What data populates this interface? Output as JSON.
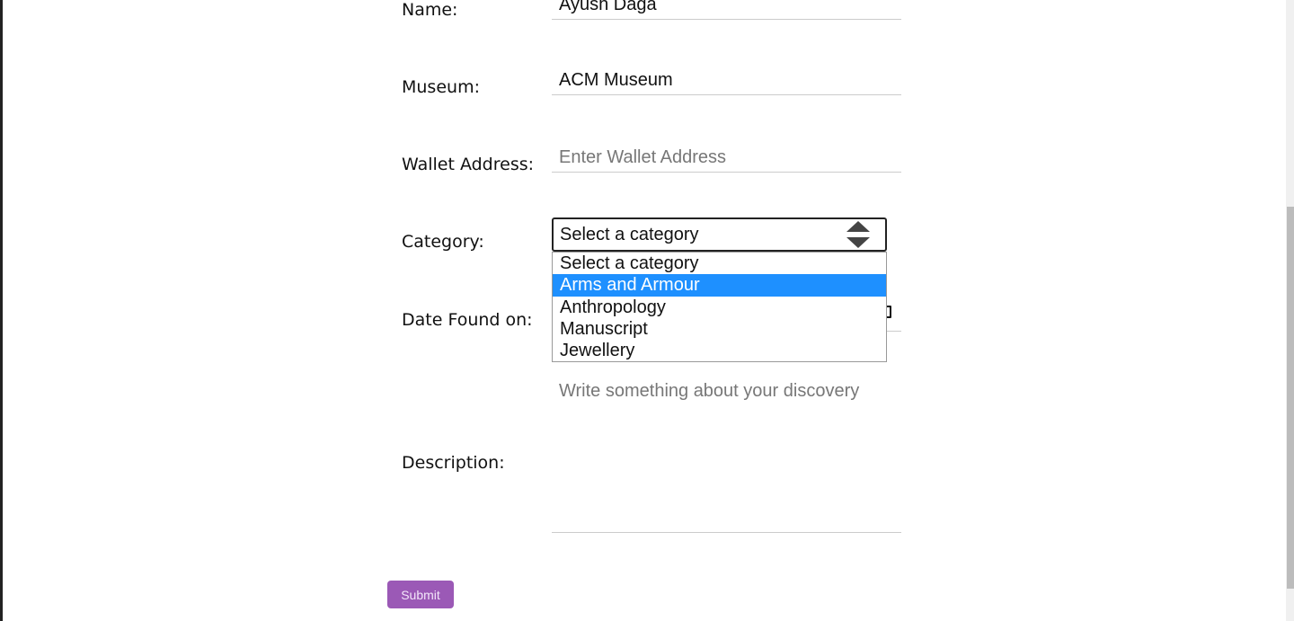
{
  "form": {
    "name": {
      "label": "Name:",
      "value": "Ayush Daga"
    },
    "museum": {
      "label": "Museum:",
      "value": "ACM Museum"
    },
    "wallet": {
      "label": "Wallet Address:",
      "placeholder": "Enter Wallet Address"
    },
    "category": {
      "label": "Category:",
      "selected": "Select a category",
      "options": [
        "Select a category",
        "Arms and Armour",
        "Anthropology",
        "Manuscript",
        "Jewellery"
      ],
      "highlighted": "Arms and Armour"
    },
    "date": {
      "label": "Date Found on:"
    },
    "description": {
      "label": "Description:",
      "placeholder": "Write something about your discovery"
    },
    "submit_label": "Submit"
  },
  "colors": {
    "submit": "#9b59b6",
    "highlight": "#1e90ff"
  }
}
